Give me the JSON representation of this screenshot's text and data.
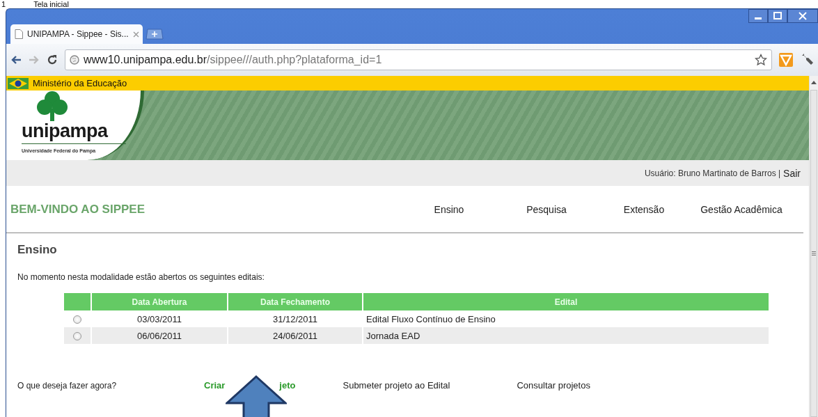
{
  "caption": {
    "number": "1",
    "title": "Tela inicial"
  },
  "browser": {
    "tabs": [
      {
        "title": "UNIPAMPA - Sippee - Sis...",
        "selected": true
      }
    ],
    "address": {
      "host": "www10.unipampa.edu.br",
      "path": "/sippee///auth.php?plataforma_id=1"
    }
  },
  "gov_bar": {
    "label": "Ministério da Educação"
  },
  "logo": {
    "name": "unipampa",
    "subtitle": "Universidade Federal do Pampa"
  },
  "user_bar": {
    "user": "Usuário: Bruno Martinato de Barros |",
    "logout": "Sair"
  },
  "nav": {
    "title": "BEM-VINDO AO SIPPEE",
    "items": [
      {
        "label": "Ensino"
      },
      {
        "label": "Pesquisa"
      },
      {
        "label": "Extensão"
      },
      {
        "label": "Gestão Acadêmica"
      }
    ]
  },
  "section": {
    "heading": "Ensino",
    "intro": "No momento nesta modalidade estão abertos os seguintes editais:"
  },
  "table": {
    "columns": [
      "Data Abertura",
      "Data Fechamento",
      "Edital"
    ],
    "rows": [
      {
        "selected": false,
        "cells": [
          "03/03/2011",
          "31/12/2011",
          "Edital Fluxo Contínuo de Ensino"
        ]
      },
      {
        "selected": false,
        "cells": [
          "06/06/2011",
          "24/06/2011",
          "Jornada EAD"
        ]
      }
    ]
  },
  "actions": {
    "prompt": "O que deseja fazer agora?",
    "items": [
      {
        "kind": "primary",
        "parts": [
          "Criar",
          "jeto"
        ]
      },
      {
        "kind": "plain",
        "parts": [
          "Submeter projeto ao Edital"
        ]
      },
      {
        "kind": "plain",
        "parts": [
          "Consultar projetos"
        ]
      }
    ]
  }
}
